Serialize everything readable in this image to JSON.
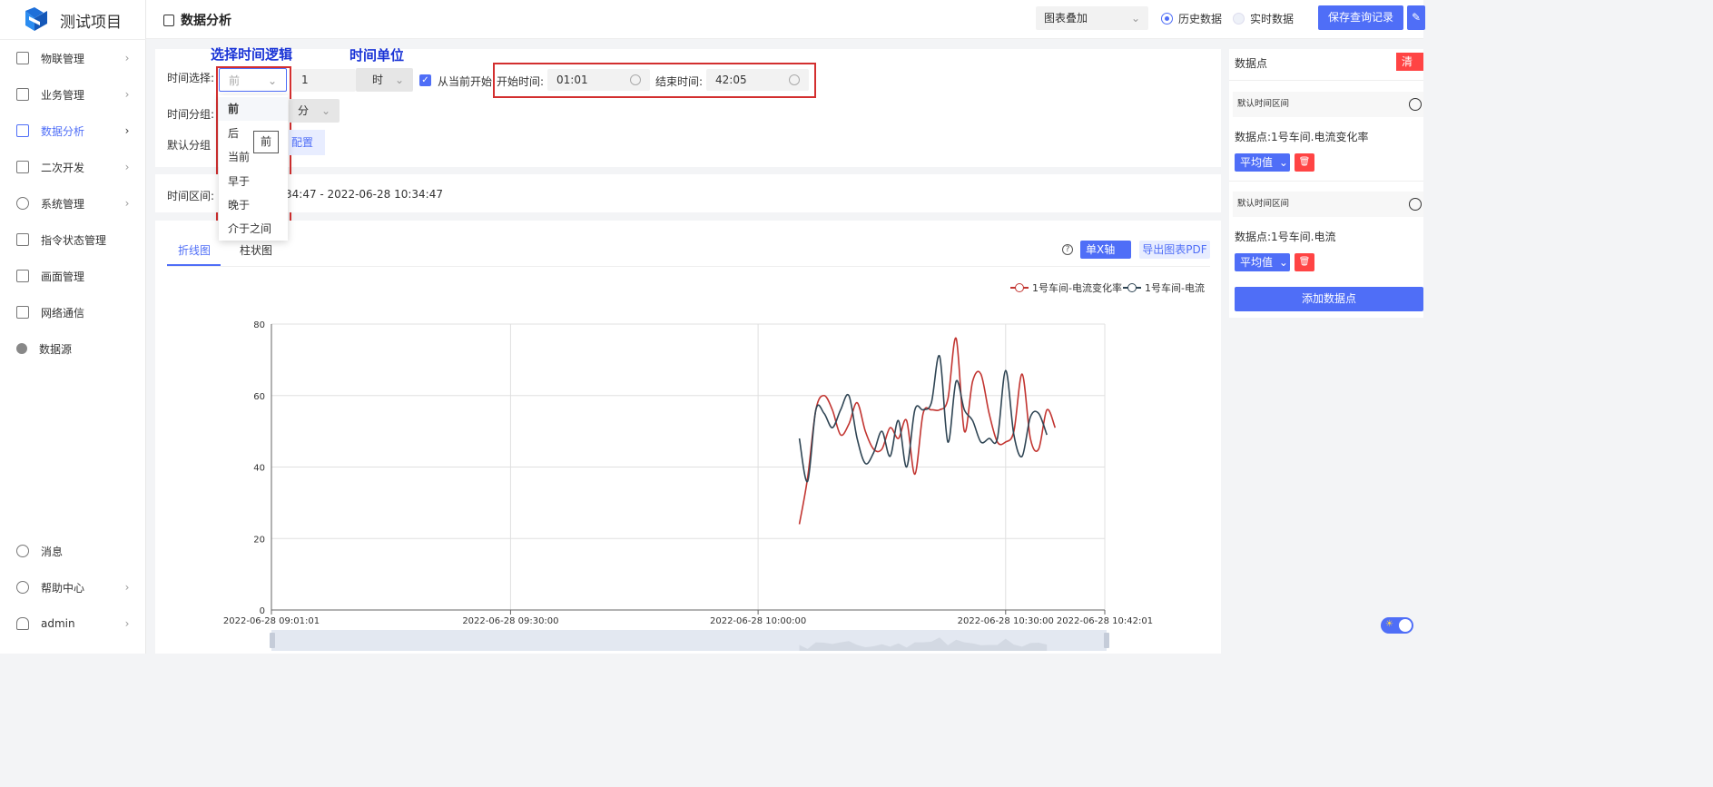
{
  "app": {
    "title": "测试项目"
  },
  "sidebar": {
    "items": [
      {
        "label": "物联管理",
        "icon": "monitor-icon"
      },
      {
        "label": "业务管理",
        "icon": "grid-icon"
      },
      {
        "label": "数据分析",
        "icon": "analysis-icon"
      },
      {
        "label": "二次开发",
        "icon": "code-icon"
      },
      {
        "label": "系统管理",
        "icon": "gear-icon"
      },
      {
        "label": "指令状态管理",
        "icon": "instruction-icon"
      },
      {
        "label": "画面管理",
        "icon": "screen-icon"
      },
      {
        "label": "网络通信",
        "icon": "list-icon"
      },
      {
        "label": "数据源",
        "icon": "datasource-icon"
      }
    ],
    "bottom": [
      {
        "label": "消息",
        "icon": "message-icon"
      },
      {
        "label": "帮助中心",
        "icon": "help-icon"
      },
      {
        "label": "admin",
        "icon": "user-icon"
      }
    ]
  },
  "header": {
    "page_title": "数据分析",
    "chart_mode": "图表叠加",
    "radio_history": "历史数据",
    "radio_realtime": "实时数据",
    "save_button": "保存查询记录"
  },
  "filter": {
    "time_select_label": "时间选择:",
    "logic_value": "前",
    "amount_value": "1",
    "unit_value": "时",
    "from_now_label": "从当前开始",
    "start_label": "开始时间:",
    "start_value": "01:01",
    "end_label": "结束时间:",
    "end_value": "42:05",
    "group_label": "时间分组:",
    "group_unit": "分",
    "default_group_label": "默认分组",
    "config_button": "配置",
    "annotation_logic": "选择时间逻辑",
    "annotation_unit": "时间单位"
  },
  "dropdown": {
    "options": [
      "前",
      "后",
      "当前",
      "早于",
      "晚于",
      "介于之间"
    ],
    "tooltip": "前"
  },
  "range": {
    "label": "时间区间:",
    "value": "34:47 - 2022-06-28 10:34:47"
  },
  "tabs": {
    "line": "折线图",
    "bar": "柱状图"
  },
  "chart_toolbar": {
    "axis_button": "单X轴",
    "export_button": "导出图表PDF"
  },
  "right_panel": {
    "title": "数据点",
    "clear_button": "清 除",
    "blocks": [
      {
        "section": "默认时间区间",
        "datapoint": "数据点:1号车间.电流变化率",
        "agg": "平均值"
      },
      {
        "section": "默认时间区间",
        "datapoint": "数据点:1号车间.电流",
        "agg": "平均值"
      }
    ],
    "add_button": "添加数据点"
  },
  "colors": {
    "accent": "#4f6ef7",
    "danger": "#f44336",
    "series_red": "#c23531",
    "series_dark": "#2f4554"
  },
  "chart_data": {
    "type": "line",
    "x_type": "time",
    "x_ticks": [
      "2022-06-28 09:01:01",
      "2022-06-28 09:30:00",
      "2022-06-28 10:00:00",
      "2022-06-28 10:30:00",
      "2022-06-28 10:42:01"
    ],
    "ylim": [
      0,
      80
    ],
    "y_ticks": [
      0,
      20,
      40,
      60,
      80
    ],
    "legend": "top-right",
    "grid": true,
    "series": [
      {
        "name": "1号车间-电流变化率",
        "color": "#c23531",
        "points": [
          [
            "10:05:00",
            24
          ],
          [
            "10:06:00",
            37
          ],
          [
            "10:07:00",
            56
          ],
          [
            "10:08:00",
            60
          ],
          [
            "10:09:00",
            56
          ],
          [
            "10:10:00",
            49
          ],
          [
            "10:11:00",
            52
          ],
          [
            "10:12:00",
            58
          ],
          [
            "10:13:00",
            50
          ],
          [
            "10:14:00",
            45
          ],
          [
            "10:15:00",
            45
          ],
          [
            "10:16:00",
            51
          ],
          [
            "10:17:00",
            48
          ],
          [
            "10:18:00",
            53
          ],
          [
            "10:19:00",
            38
          ],
          [
            "10:20:00",
            55
          ],
          [
            "10:21:00",
            56
          ],
          [
            "10:22:00",
            56
          ],
          [
            "10:23:00",
            59
          ],
          [
            "10:24:00",
            76
          ],
          [
            "10:25:00",
            50
          ],
          [
            "10:26:00",
            64
          ],
          [
            "10:27:00",
            66
          ],
          [
            "10:28:00",
            55
          ],
          [
            "10:29:00",
            47
          ],
          [
            "10:30:00",
            47
          ],
          [
            "10:31:00",
            50
          ],
          [
            "10:32:00",
            66
          ],
          [
            "10:33:00",
            48
          ],
          [
            "10:34:00",
            45
          ],
          [
            "10:35:00",
            56
          ],
          [
            "10:36:00",
            51
          ]
        ]
      },
      {
        "name": "1号车间-电流",
        "color": "#2f4554",
        "points": [
          [
            "10:05:00",
            48
          ],
          [
            "10:06:00",
            36
          ],
          [
            "10:07:00",
            56
          ],
          [
            "10:08:00",
            55
          ],
          [
            "10:09:00",
            51
          ],
          [
            "10:10:00",
            56
          ],
          [
            "10:11:00",
            60
          ],
          [
            "10:12:00",
            48
          ],
          [
            "10:13:00",
            41
          ],
          [
            "10:14:00",
            44
          ],
          [
            "10:15:00",
            50
          ],
          [
            "10:16:00",
            43
          ],
          [
            "10:17:00",
            53
          ],
          [
            "10:18:00",
            40
          ],
          [
            "10:19:00",
            56
          ],
          [
            "10:20:00",
            56
          ],
          [
            "10:21:00",
            58
          ],
          [
            "10:22:00",
            71
          ],
          [
            "10:23:00",
            47
          ],
          [
            "10:24:00",
            64
          ],
          [
            "10:25:00",
            56
          ],
          [
            "10:26:00",
            53
          ],
          [
            "10:27:00",
            47
          ],
          [
            "10:28:00",
            48
          ],
          [
            "10:29:00",
            48
          ],
          [
            "10:30:00",
            67
          ],
          [
            "10:31:00",
            49
          ],
          [
            "10:32:00",
            43
          ],
          [
            "10:33:00",
            54
          ],
          [
            "10:34:00",
            55
          ],
          [
            "10:35:00",
            49
          ]
        ]
      }
    ]
  }
}
